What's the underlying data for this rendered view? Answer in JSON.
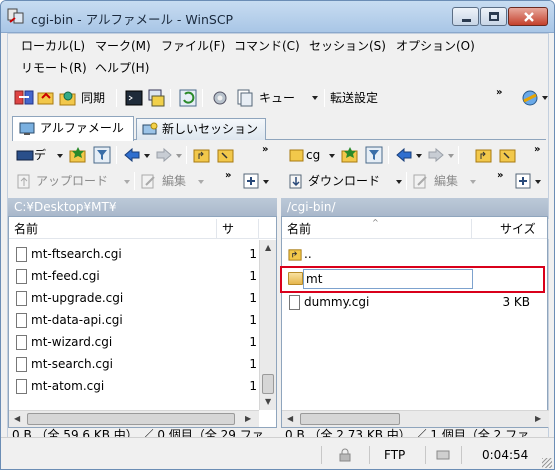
{
  "window": {
    "title": "cgi-bin - アルファメール - WinSCP"
  },
  "menu": {
    "row1": [
      "ローカル(L)",
      "マーク(M)",
      "ファイル(F)",
      "コマンド(C)",
      "セッション(S)",
      "オプション(O)"
    ],
    "row2": [
      "リモート(R)",
      "ヘルプ(H)"
    ]
  },
  "toolbar": {
    "sync_label": "同期",
    "queue_label": "キュー",
    "transfer_label": "転送設定"
  },
  "tabs": [
    {
      "label": "アルファメール"
    },
    {
      "label": "新しいセッション"
    }
  ],
  "local": {
    "drive_label": "デ",
    "upload_label": "アップロード",
    "edit_label": "編集",
    "path": "C:¥Desktop¥MT¥",
    "col_name": "名前",
    "col_size": "サ",
    "files": [
      {
        "name": "mt-ftsearch.cgi",
        "size": "1"
      },
      {
        "name": "mt-feed.cgi",
        "size": "1"
      },
      {
        "name": "mt-upgrade.cgi",
        "size": "1"
      },
      {
        "name": "mt-data-api.cgi",
        "size": "1"
      },
      {
        "name": "mt-wizard.cgi",
        "size": "1"
      },
      {
        "name": "mt-search.cgi",
        "size": "1"
      },
      {
        "name": "mt-atom.cgi",
        "size": "1"
      }
    ],
    "status": "0 B （全 59.6 KB 中） ／ 0 個目（全 29 ファ..."
  },
  "remote": {
    "drive_label": "cg",
    "download_label": "ダウンロード",
    "edit_label": "編集",
    "path": "/cgi-bin/",
    "col_name": "名前",
    "col_size": "サイズ",
    "parent_label": "..",
    "editing_folder": "mt",
    "files": [
      {
        "name": "dummy.cgi",
        "size": "3 KB"
      }
    ],
    "status": "0 B （全 2.73 KB 中） ／ 1 個目（全 2 ファ..."
  },
  "bottom": {
    "protocol": "FTP",
    "elapsed": "0:04:54"
  }
}
